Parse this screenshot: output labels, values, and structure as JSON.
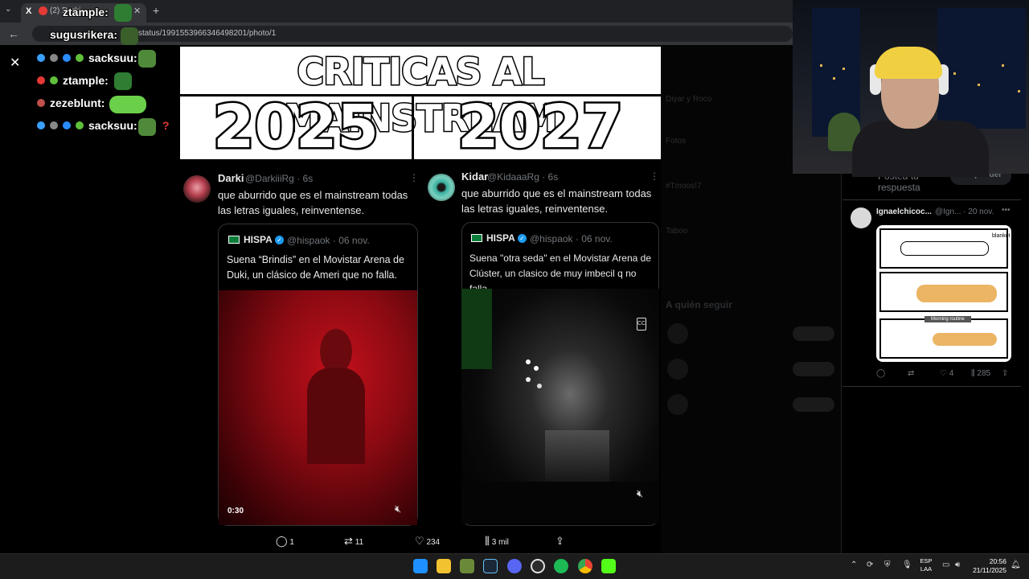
{
  "browser": {
    "tab_title": "(2) Darki...",
    "url": "status/1991553966346498201/photo/1"
  },
  "chat": [
    {
      "user": "ztample:",
      "color": "#ffffff"
    },
    {
      "user": "sugusrikera:",
      "color": "#ffffff"
    },
    {
      "user": "sacksuu:",
      "color": "#ffffff"
    },
    {
      "user": "ztample:",
      "color": "#ffffff"
    },
    {
      "user": "zezeblunt:",
      "color": "#ffffff"
    },
    {
      "user": "sacksuu:",
      "color": "#ffffff"
    }
  ],
  "thumbnail": {
    "title": "CRITICAS AL MAINSTREAM",
    "year_left": "2025",
    "year_right": "2027"
  },
  "tweet_left": {
    "name": "Darki",
    "handle": "@DarkiiiRg · 6s",
    "text": "que aburrido que es el mainstream todas las letras iguales, reinventense.",
    "quote": {
      "name": "HISPA",
      "handle": "@hispaok · 06 nov.",
      "text": "Suena “Brindis” en el Movistar Arena de Duki, un clásico de Ameri que no falla.",
      "video_time": "0:30"
    }
  },
  "tweet_right": {
    "name": "Kidar",
    "handle": "@KidaaaRg · 6s",
    "text": "que aburrido que es el mainstream todas las letras iguales, reinventense.",
    "quote": {
      "name": "HISPA",
      "handle": "@hispaok · 06 nov.",
      "text": "Suena \"otra seda\" en el Movistar Arena de Clúster, un clasico de muy imbecil q no falla"
    }
  },
  "actions": {
    "replies": "1",
    "reposts": "11",
    "likes": "234",
    "views": "3 mil"
  },
  "reply_panel": {
    "compose_placeholder": "Postea tu respuesta",
    "reply_button": "Responder",
    "reply_name": "Ignaelchicoc...",
    "reply_handle": "@Ign... · 20 nov.",
    "meme_label": "Morning routine",
    "meme_blanket": "blanket",
    "likes": "4",
    "views": "285"
  },
  "taskbar": {
    "lang_line1": "ESP",
    "lang_line2": "LAA",
    "time": "20:56",
    "date": "21/11/2025"
  }
}
